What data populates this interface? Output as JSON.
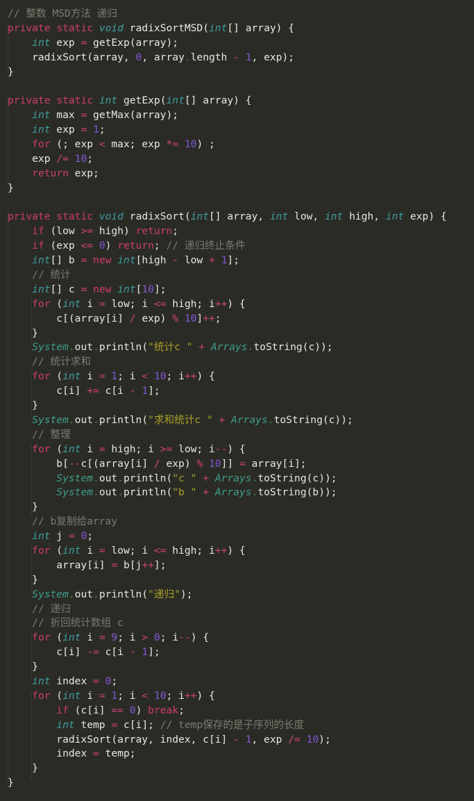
{
  "editor": {
    "language": "java",
    "theme_background": "#2b2b26",
    "foreground": "#e8e8e3",
    "indent_guide_color": "#3d3d36",
    "syntax_colors": {
      "keyword": "#cc3d68",
      "type": "#3d9e9e",
      "class": "#3d9e8a",
      "number": "#8258d6",
      "string": "#a8a227",
      "comment": "#7b7b72",
      "operator": "#d2437a",
      "member_dot": "#3f8a3f"
    }
  },
  "code": {
    "lines": [
      "// 整数 MSD方法 递归",
      "private static void radixSortMSD(int[] array) {",
      "    int exp = getExp(array);",
      "    radixSort(array, 0, array.length - 1, exp);",
      "}",
      "",
      "private static int getExp(int[] array) {",
      "    int max = getMax(array);",
      "    int exp = 1;",
      "    for (; exp < max; exp *= 10) ;",
      "    exp /= 10;",
      "    return exp;",
      "}",
      "",
      "private static void radixSort(int[] array, int low, int high, int exp) {",
      "    if (low >= high) return;",
      "    if (exp <= 0) return; // 递归终止条件",
      "    int[] b = new int[high - low + 1];",
      "    // 统计",
      "    int[] c = new int[10];",
      "    for (int i = low; i <= high; i++) {",
      "        c[(array[i] / exp) % 10]++;",
      "    }",
      "    System.out.println(\"统计c \" + Arrays.toString(c));",
      "    // 统计求和",
      "    for (int i = 1; i < 10; i++) {",
      "        c[i] += c[i - 1];",
      "    }",
      "    System.out.println(\"求和统计c \" + Arrays.toString(c));",
      "    // 整理",
      "    for (int i = high; i >= low; i--) {",
      "        b[--c[(array[i] / exp) % 10]] = array[i];",
      "        System.out.println(\"c \" + Arrays.toString(c));",
      "        System.out.println(\"b \" + Arrays.toString(b));",
      "    }",
      "    // b复制给array",
      "    int j = 0;",
      "    for (int i = low; i <= high; i++) {",
      "        array[i] = b[j++];",
      "    }",
      "    System.out.println(\"递归\");",
      "    // 递归",
      "    // 折回统计数组 c",
      "    for (int i = 9; i > 0; i--) {",
      "        c[i] -= c[i - 1];",
      "    }",
      "    int index = 0;",
      "    for (int i = 1; i < 10; i++) {",
      "        if (c[i] == 0) break;",
      "        int temp = c[i]; // temp保存的是子序列的长度",
      "        radixSort(array, index, c[i] - 1, exp /= 10);",
      "        index = temp;",
      "    }",
      "}"
    ],
    "comments": [
      "// 整数 MSD方法 递归",
      "// 递归终止条件",
      "// 统计",
      "// 统计求和",
      "// 整理",
      "// b复制给array",
      "// 递归",
      "// 折回统计数组 c",
      "// temp保存的是子序列的长度"
    ],
    "strings": [
      "\"统计c \"",
      "\"求和统计c \"",
      "\"c \"",
      "\"b \"",
      "\"递归\""
    ],
    "methods": [
      "radixSortMSD",
      "getExp",
      "radixSort",
      "getMax",
      "toString",
      "println"
    ],
    "keywords": [
      "private",
      "static",
      "void",
      "int",
      "new",
      "for",
      "if",
      "return",
      "break"
    ],
    "line_count": 52
  }
}
